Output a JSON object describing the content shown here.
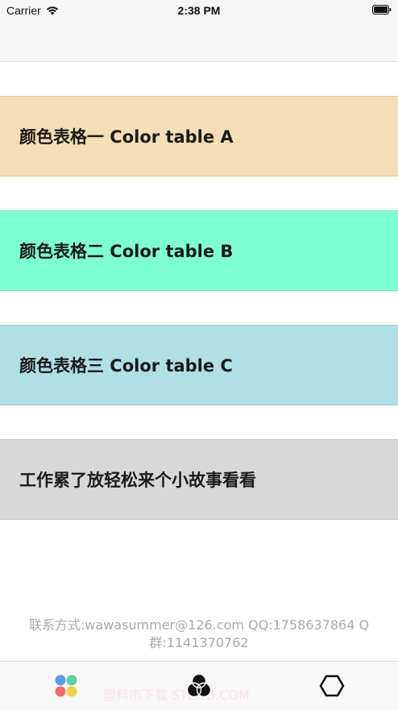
{
  "status_bar": {
    "carrier": "Carrier",
    "time": "2:38 PM"
  },
  "rows": [
    {
      "label": "颜色表格一 Color table A",
      "color": "#f5deb3"
    },
    {
      "label": "颜色表格二 Color table B",
      "color": "#7fffd4"
    },
    {
      "label": "颜色表格三 Color table C",
      "color": "#b0e0e6"
    },
    {
      "label": "工作累了放轻松来个小故事看看",
      "color": "#d8d8d8"
    }
  ],
  "contact": {
    "line1": "联系方式:wawasummer@126.com QQ:1758637864 Q",
    "line2": "群:1141370762"
  },
  "watermark": "塑料市下载 STEDU.COM",
  "tabs": [
    {
      "icon": "colored-dots-icon"
    },
    {
      "icon": "three-circles-icon"
    },
    {
      "icon": "hexagon-icon"
    }
  ]
}
